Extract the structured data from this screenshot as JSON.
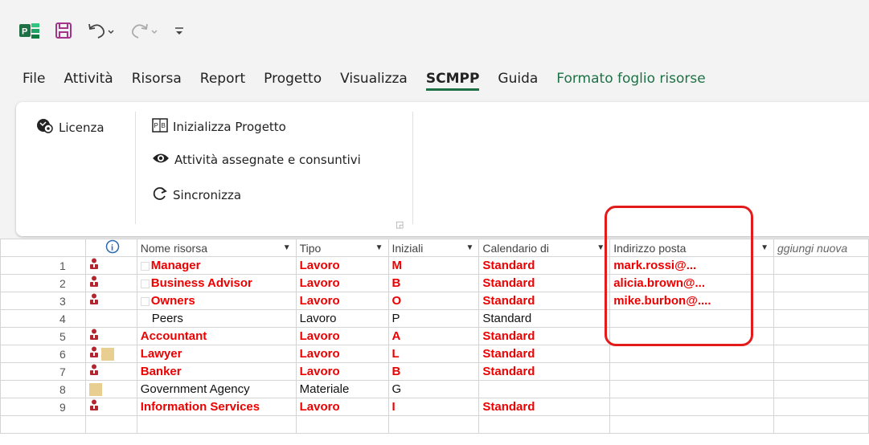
{
  "quick_access": {
    "app_icon": "project-app-icon",
    "save_icon": "save-icon",
    "undo_icon": "undo-icon",
    "redo_icon": "redo-icon",
    "customize_icon": "customize-qat-icon"
  },
  "menu": {
    "tabs": [
      {
        "label": "File"
      },
      {
        "label": "Attività"
      },
      {
        "label": "Risorsa"
      },
      {
        "label": "Report"
      },
      {
        "label": "Progetto"
      },
      {
        "label": "Visualizza"
      },
      {
        "label": "SCMPP",
        "active": true
      },
      {
        "label": "Guida"
      },
      {
        "label": "Formato foglio risorse",
        "contextual": true
      }
    ]
  },
  "ribbon": {
    "licenza": "Licenza",
    "inizializza": "Inizializza Progetto",
    "attivita": "Attività assegnate e consuntivi",
    "sincronizza": "Sincronizza"
  },
  "grid": {
    "headers": {
      "nome": "Nome risorsa",
      "tipo": "Tipo",
      "iniziali": "Iniziali",
      "calendario": "Calendario di",
      "email": "Indirizzo posta",
      "add": "ggiungi nuova"
    },
    "rows": [
      {
        "num": "1",
        "name": "Manager",
        "tipo": "Lavoro",
        "iniz": "M",
        "cal": "Standard",
        "email": "mark.rossi@..."
      },
      {
        "num": "2",
        "name": "Business Advisor",
        "tipo": "Lavoro",
        "iniz": "B",
        "cal": "Standard",
        "email": "alicia.brown@..."
      },
      {
        "num": "3",
        "name": "Owners",
        "tipo": "Lavoro",
        "iniz": "O",
        "cal": "Standard",
        "email": "mike.burbon@...."
      },
      {
        "num": "4",
        "name": "Peers",
        "tipo": "Lavoro",
        "iniz": "P",
        "cal": "Standard",
        "email": ""
      },
      {
        "num": "5",
        "name": "Accountant",
        "tipo": "Lavoro",
        "iniz": "A",
        "cal": "Standard",
        "email": ""
      },
      {
        "num": "6",
        "name": "Lawyer",
        "tipo": "Lavoro",
        "iniz": "L",
        "cal": "Standard",
        "email": ""
      },
      {
        "num": "7",
        "name": "Banker",
        "tipo": "Lavoro",
        "iniz": "B",
        "cal": "Standard",
        "email": ""
      },
      {
        "num": "8",
        "name": "Government Agency",
        "tipo": "Materiale",
        "iniz": "G",
        "cal": "",
        "email": ""
      },
      {
        "num": "9",
        "name": "Information Services",
        "tipo": "Lavoro",
        "iniz": "I",
        "cal": "Standard",
        "email": ""
      }
    ]
  },
  "colors": {
    "highlight": "#e31b1b",
    "critical_text": "#ee0000",
    "accent": "#1e7145"
  }
}
